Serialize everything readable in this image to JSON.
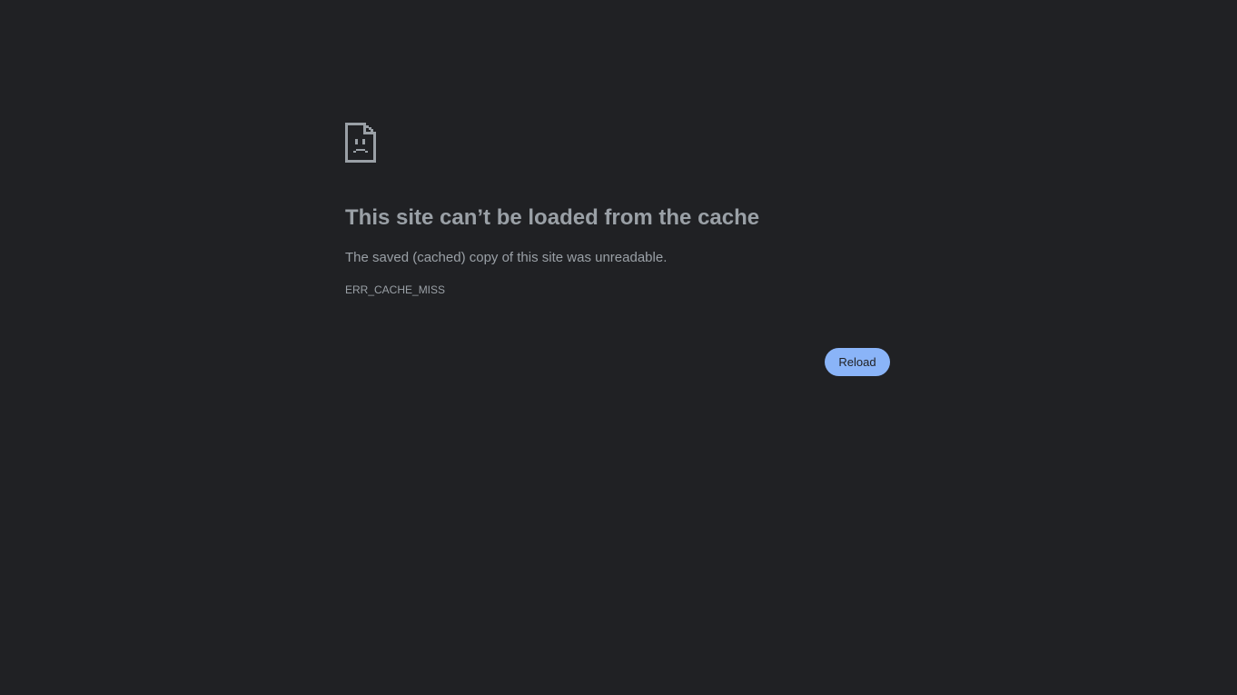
{
  "error": {
    "icon": "sad-page-icon",
    "title": "This site can’t be loaded from the cache",
    "description": "The saved (cached) copy of this site was unreadable.",
    "code": "ERR_CACHE_MISS"
  },
  "actions": {
    "reload_label": "Reload"
  },
  "colors": {
    "background": "#202124",
    "text": "#9aa0a6",
    "button": "#8ab4f8",
    "button_text": "#202124"
  }
}
